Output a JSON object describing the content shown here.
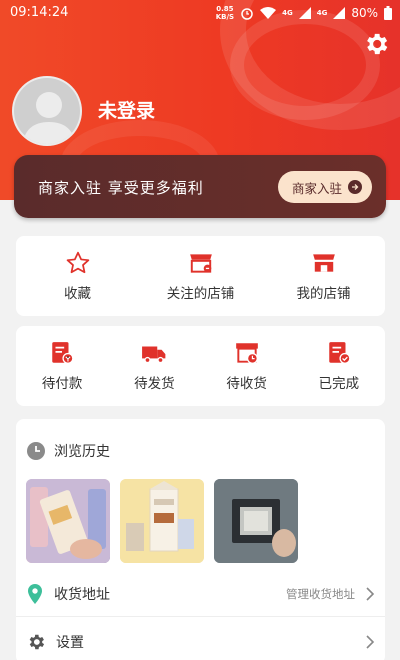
{
  "status_bar": {
    "time": "09:14:24",
    "net_speed_value": "0.85",
    "net_speed_unit": "KB/S",
    "sim1": "4G",
    "sim2": "4G",
    "battery": "80%"
  },
  "profile": {
    "login_text": "未登录"
  },
  "merchant_banner": {
    "title": "商家入驻 享受更多福利",
    "button_label": "商家入驻"
  },
  "shortcuts": [
    {
      "label": "收藏",
      "icon": "star-icon"
    },
    {
      "label": "关注的店铺",
      "icon": "followed-store-icon"
    },
    {
      "label": "我的店铺",
      "icon": "store-icon"
    }
  ],
  "orders": [
    {
      "label": "待付款",
      "icon": "pending-payment-icon"
    },
    {
      "label": "待发货",
      "icon": "delivery-truck-icon"
    },
    {
      "label": "待收货",
      "icon": "pending-receipt-icon"
    },
    {
      "label": "已完成",
      "icon": "completed-icon"
    }
  ],
  "history": {
    "title": "浏览历史"
  },
  "menu": {
    "address_label": "收货地址",
    "address_hint": "管理收货地址",
    "settings_label": "设置"
  },
  "colors": {
    "header_red": "#ee3a23",
    "icon_red": "#e0322b",
    "banner_brown": "#5a2b2b",
    "button_cream": "#fbe3cc",
    "location_green": "#3dbf9a"
  }
}
